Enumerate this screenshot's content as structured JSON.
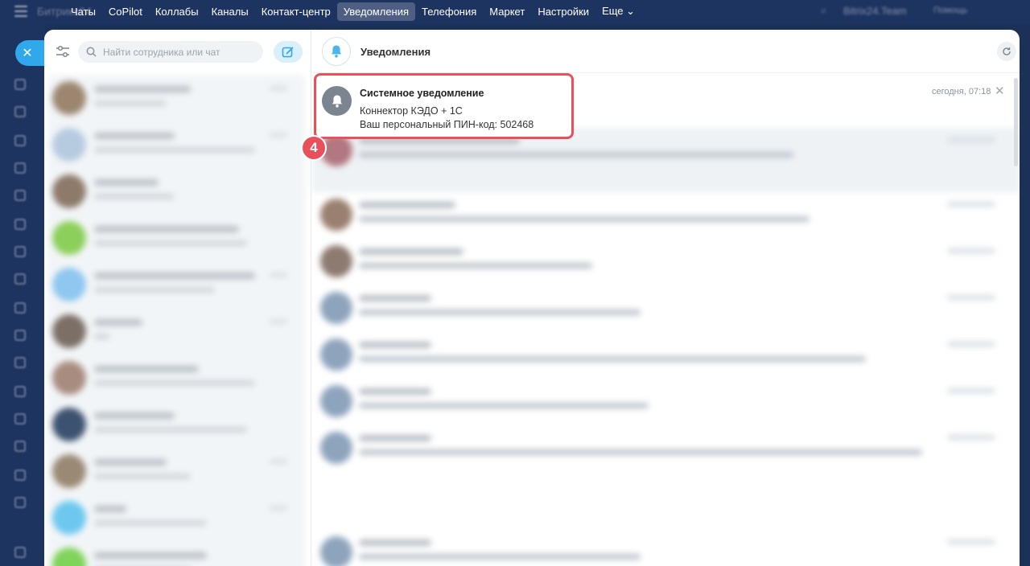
{
  "topbar": {
    "brand": "Битрикс24",
    "menu": [
      {
        "label": "Чаты"
      },
      {
        "label": "CoPilot"
      },
      {
        "label": "Коллабы"
      },
      {
        "label": "Каналы"
      },
      {
        "label": "Контакт-центр"
      },
      {
        "label": "Уведомления",
        "active": true
      },
      {
        "label": "Телефония"
      },
      {
        "label": "Маркет"
      },
      {
        "label": "Настройки"
      },
      {
        "label": "Еще ⌄"
      }
    ],
    "account": "Bitrix24.Team",
    "help": "Помощь"
  },
  "sidebar": {
    "close_symbol": "✕",
    "search_placeholder": "Найти сотрудника или чат"
  },
  "notifications": {
    "title": "Уведомления",
    "highlighted": {
      "title": "Системное уведомление",
      "line1": "Коннектор КЭДО + 1С",
      "line2": "Ваш персональный ПИН-код: 502468",
      "time": "сегодня, 07:18",
      "close_symbol": "✕"
    },
    "step_badge": "4"
  },
  "colors": {
    "accent": "#2fa8ec",
    "highlight": "#e8505b",
    "nav_bg": "#1d3360"
  }
}
